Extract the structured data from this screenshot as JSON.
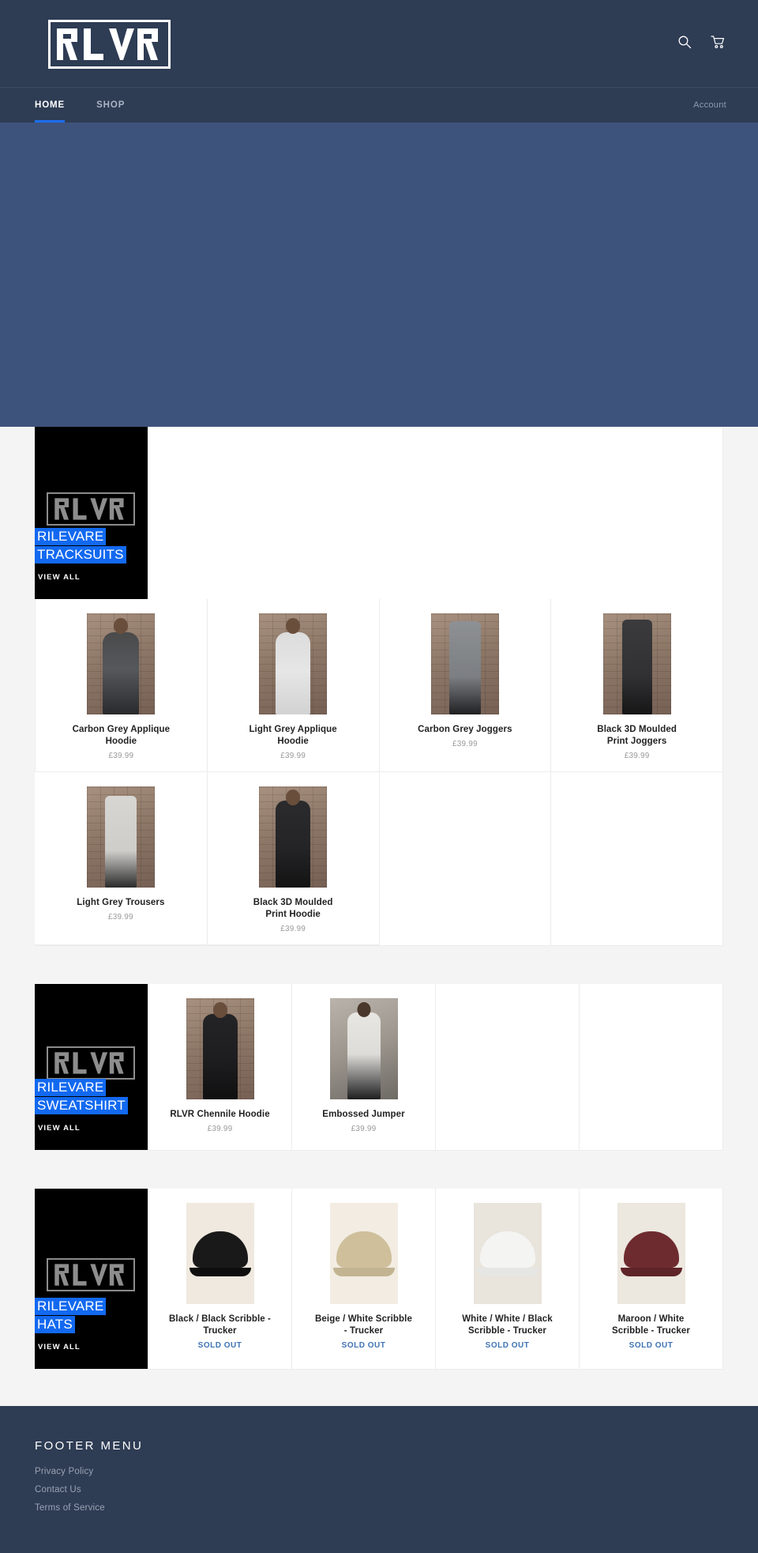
{
  "header": {
    "logo_text": "RLVR",
    "icons": [
      {
        "name": "search-icon",
        "label": "Search"
      },
      {
        "name": "cart-icon",
        "label": "Cart"
      }
    ]
  },
  "nav": {
    "items": [
      {
        "label": "HOME",
        "active": true
      },
      {
        "label": "SHOP",
        "active": false
      }
    ],
    "account_label": "Account"
  },
  "collections": [
    {
      "promo": {
        "logo_text": "RLVR",
        "title_line1": "RILEVARE",
        "title_line2": "TRACKSUITS",
        "view_all": "VIEW ALL"
      },
      "products": [
        {
          "title": "Carbon Grey Applique Hoodie",
          "price": "£39.99",
          "sold_out": false
        },
        {
          "title": "Light Grey Applique Hoodie",
          "price": "£39.99",
          "sold_out": false
        },
        {
          "title": "Carbon Grey Joggers",
          "price": "£39.99",
          "sold_out": false
        },
        {
          "title": "Black 3D Moulded Print Joggers",
          "price": "£39.99",
          "sold_out": false
        },
        {
          "title": "Light Grey Trousers",
          "price": "£39.99",
          "sold_out": false
        },
        {
          "title": "Black 3D Moulded Print Hoodie",
          "price": "£39.99",
          "sold_out": false
        }
      ]
    },
    {
      "promo": {
        "logo_text": "RLVR",
        "title_line1": "RILEVARE",
        "title_line2": "SWEATSHIRT",
        "view_all": "VIEW ALL"
      },
      "products": [
        {
          "title": "RLVR Chennile Hoodie",
          "price": "£39.99",
          "sold_out": false
        },
        {
          "title": "Embossed Jumper",
          "price": "£39.99",
          "sold_out": false
        }
      ]
    },
    {
      "promo": {
        "logo_text": "RLVR",
        "title_line1": "RILEVARE",
        "title_line2": "HATS",
        "view_all": "VIEW ALL"
      },
      "products": [
        {
          "title": "Black / Black Scribble - Trucker",
          "price": "SOLD OUT",
          "sold_out": true
        },
        {
          "title": "Beige / White Scribble - Trucker",
          "price": "SOLD OUT",
          "sold_out": true
        },
        {
          "title": "White / White / Black Scribble - Trucker",
          "price": "SOLD OUT",
          "sold_out": true
        },
        {
          "title": "Maroon / White Scribble - Trucker",
          "price": "SOLD OUT",
          "sold_out": true
        }
      ]
    }
  ],
  "footer": {
    "title": "FOOTER MENU",
    "links": [
      {
        "label": "Privacy Policy"
      },
      {
        "label": "Contact Us"
      },
      {
        "label": "Terms of Service"
      }
    ]
  },
  "colors": {
    "header_bg": "#2e3c54",
    "hero_bg": "#3e537c",
    "accent_blue": "#1269f0",
    "nav_active_underline": "#1c6ef2",
    "sold_out": "#3f74b5",
    "page_bg": "#f4f4f4"
  }
}
